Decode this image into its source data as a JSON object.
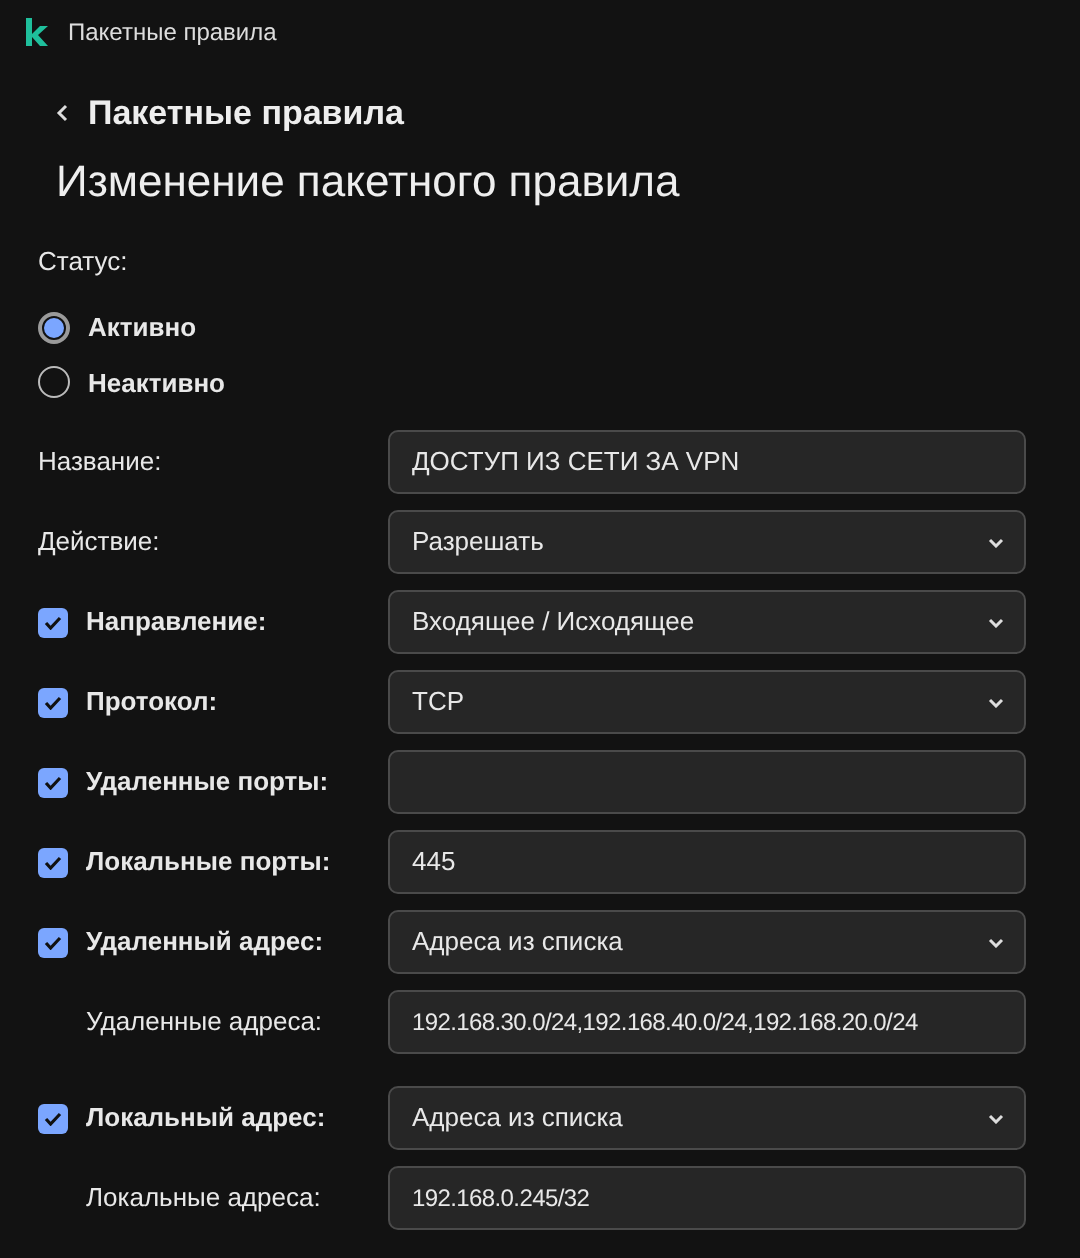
{
  "window": {
    "title": "Пакетные правила"
  },
  "back": {
    "label": "Пакетные правила"
  },
  "heading": "Изменение пакетного правила",
  "status": {
    "label": "Статус:",
    "options": [
      {
        "label": "Активно",
        "selected": true
      },
      {
        "label": "Неактивно",
        "selected": false
      }
    ]
  },
  "rows": [
    {
      "label": "Название:",
      "kind": "text",
      "value": "ДОСТУП ИЗ СЕТИ ЗА VPN"
    },
    {
      "label": "Действие:",
      "kind": "select",
      "value": "Разрешать"
    },
    {
      "checked": true,
      "label": "Направление:",
      "kind": "select",
      "value": "Входящее / Исходящее"
    },
    {
      "checked": true,
      "label": "Протокол:",
      "kind": "select",
      "value": "TCP"
    },
    {
      "checked": true,
      "label": "Удаленные порты:",
      "kind": "text"
    },
    {
      "checked": true,
      "label": "Локальные порты:",
      "kind": "text",
      "value": "445"
    },
    {
      "checked": true,
      "label": "Удаленный адрес:",
      "kind": "select",
      "value": "Адреса из списка",
      "children": [
        {
          "label": "Удаленные адреса:",
          "kind": "text",
          "value": "192.168.30.0/24,192.168.40.0/24,192.168.20.0/24"
        }
      ]
    },
    {
      "checked": true,
      "label": "Локальный адрес:",
      "kind": "select",
      "value": "Адреса из списка",
      "children": [
        {
          "label": "Локальные адреса:",
          "kind": "text",
          "value": "192.168.0.245/32"
        }
      ]
    }
  ]
}
